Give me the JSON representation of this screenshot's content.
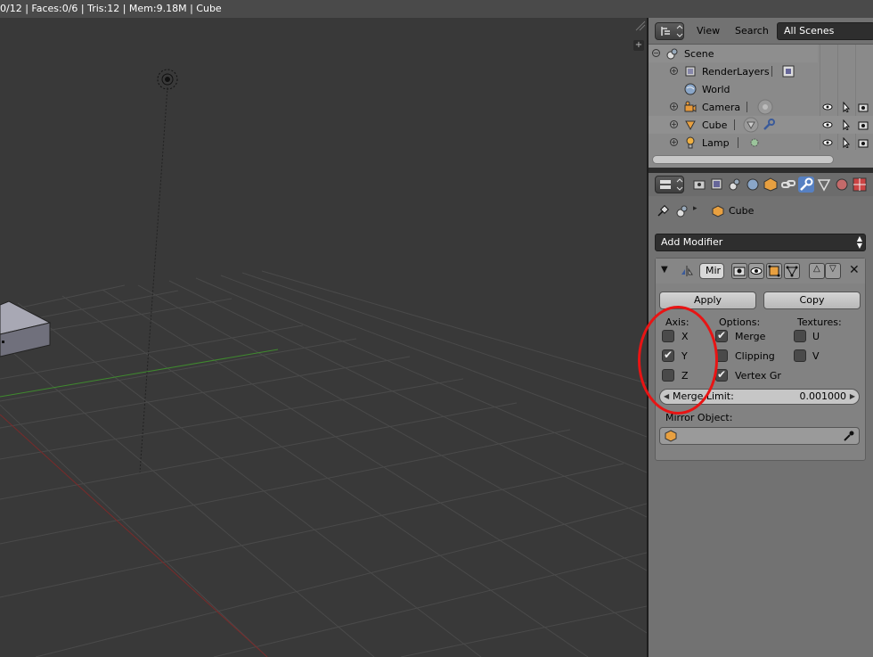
{
  "infobar": {
    "text": "0/12 | Faces:0/6 | Tris:12 | Mem:9.18M | Cube"
  },
  "outliner": {
    "menu": {
      "view": "View",
      "search": "Search"
    },
    "scene_select": "All Scenes",
    "rows": [
      {
        "label": "Scene"
      },
      {
        "label": "RenderLayers"
      },
      {
        "label": "World"
      },
      {
        "label": "Camera"
      },
      {
        "label": "Cube"
      },
      {
        "label": "Lamp"
      }
    ]
  },
  "properties": {
    "breadcrumb_object": "Cube",
    "add_modifier": "Add Modifier",
    "modifier": {
      "name": "Mir",
      "apply": "Apply",
      "copy": "Copy",
      "axis_head": "Axis:",
      "options_head": "Options:",
      "textures_head": "Textures:",
      "axis": [
        {
          "label": "X",
          "checked": false
        },
        {
          "label": "Y",
          "checked": true
        },
        {
          "label": "Z",
          "checked": false
        }
      ],
      "options": [
        {
          "label": "Merge",
          "checked": true
        },
        {
          "label": "Clipping",
          "checked": false
        },
        {
          "label": "Vertex Gr",
          "checked": true
        }
      ],
      "textures": [
        {
          "label": "U",
          "checked": false
        },
        {
          "label": "V",
          "checked": false
        }
      ],
      "merge_limit_label": "Merge Limit:",
      "merge_limit_value": "0.001000",
      "mirror_object_label": "Mirror Object:"
    }
  },
  "colors": {
    "accent": "#5680c2",
    "annotation": "#e81414",
    "x_axis": "#8b2a2a",
    "y_axis": "#3f8a2e"
  }
}
